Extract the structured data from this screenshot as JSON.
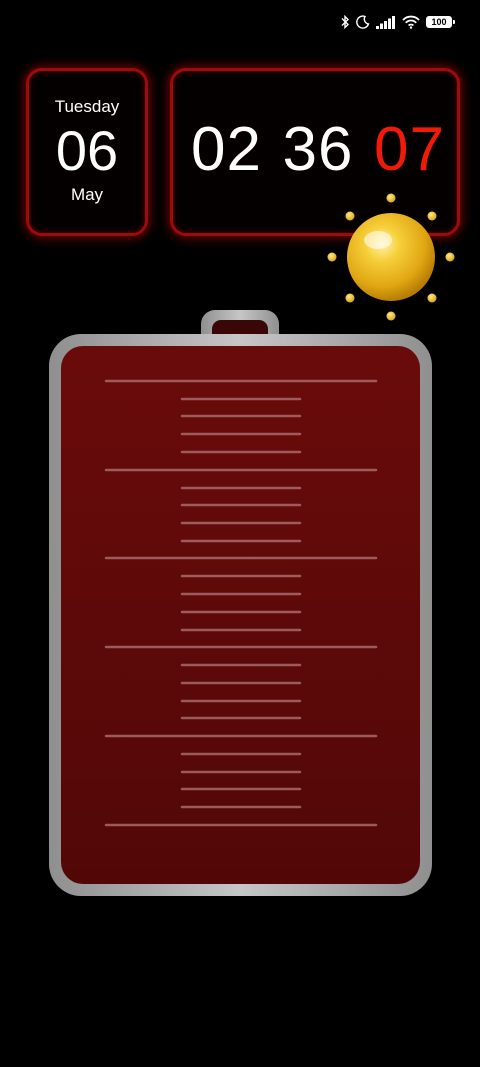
{
  "status_bar": {
    "battery_level": "100",
    "icons": [
      "bluetooth-icon",
      "moon-icon",
      "signal-icon",
      "wifi-icon",
      "battery-icon"
    ]
  },
  "date_widget": {
    "weekday": "Tuesday",
    "day": "06",
    "month": "May"
  },
  "clock_widget": {
    "hours": "02",
    "minutes": "36",
    "seconds": "07"
  },
  "weather_widget": {
    "icon": "sun-icon",
    "color": "#f2c21d"
  },
  "battery_widget": {
    "icon": "battery-gauge",
    "fill_color": "#5e0909",
    "frame_color": "#a7a7a7"
  }
}
